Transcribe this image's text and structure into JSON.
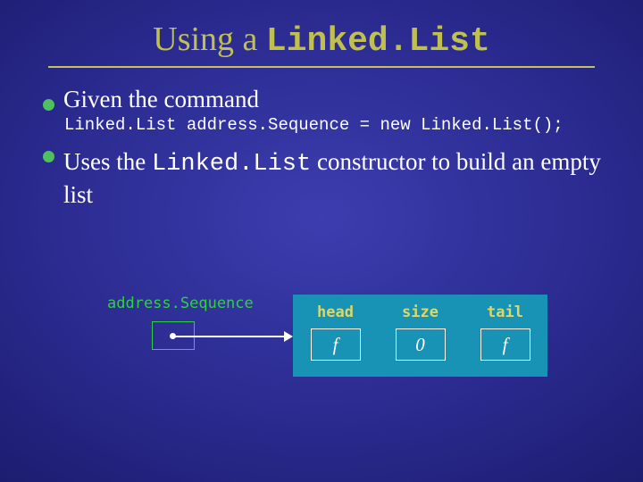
{
  "title": {
    "prefix": "Using a ",
    "class": "Linked.List"
  },
  "bullets": {
    "b1_prefix": "Given the command",
    "codeline": "Linked.List address.Sequence = new Linked.List();",
    "b2_part1": "Uses the ",
    "b2_class": "Linked.List",
    "b2_part2": " constructor to build an empty list"
  },
  "diagram": {
    "ptr_label": "address.Sequence",
    "fields": {
      "head": {
        "label": "head",
        "value": "f"
      },
      "size": {
        "label": "size",
        "value": "0"
      },
      "tail": {
        "label": "tail",
        "value": "f"
      }
    }
  }
}
